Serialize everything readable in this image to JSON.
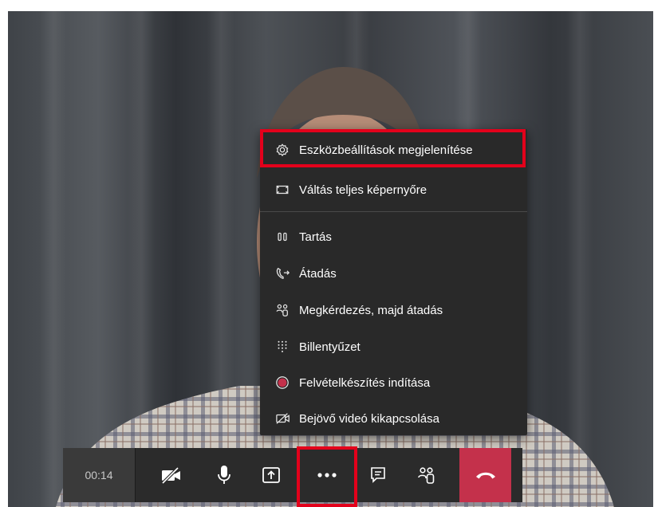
{
  "more_menu": {
    "items": [
      {
        "icon": "gear-icon",
        "label": "Eszközbeállítások megjelenítése"
      },
      {
        "icon": "fullscreen-icon",
        "label": "Váltás teljes képernyőre"
      },
      {
        "icon": "pause-icon",
        "label": "Tartás"
      },
      {
        "icon": "transfer-icon",
        "label": "Átadás"
      },
      {
        "icon": "consult-transfer-icon",
        "label": "Megkérdezés, majd átadás"
      },
      {
        "icon": "dialpad-icon",
        "label": "Billentyűzet"
      },
      {
        "icon": "record-icon",
        "label": "Felvételkészítés indítása"
      },
      {
        "icon": "video-off-icon",
        "label": "Bejövő videó kikapcsolása"
      }
    ]
  },
  "call_controls": {
    "timer": "00:14",
    "buttons": [
      {
        "icon": "video-off-icon"
      },
      {
        "icon": "microphone-icon"
      },
      {
        "icon": "share-screen-icon"
      },
      {
        "icon": "more-actions-icon"
      },
      {
        "icon": "chat-icon"
      },
      {
        "icon": "participants-icon"
      },
      {
        "icon": "hang-up-icon"
      }
    ]
  },
  "colors": {
    "highlight": "#e3001b",
    "hang_up": "#c4314b",
    "record_dot": "#c4314b",
    "menu_background": "#292929",
    "toolbar_background": "#2b2b2b"
  }
}
